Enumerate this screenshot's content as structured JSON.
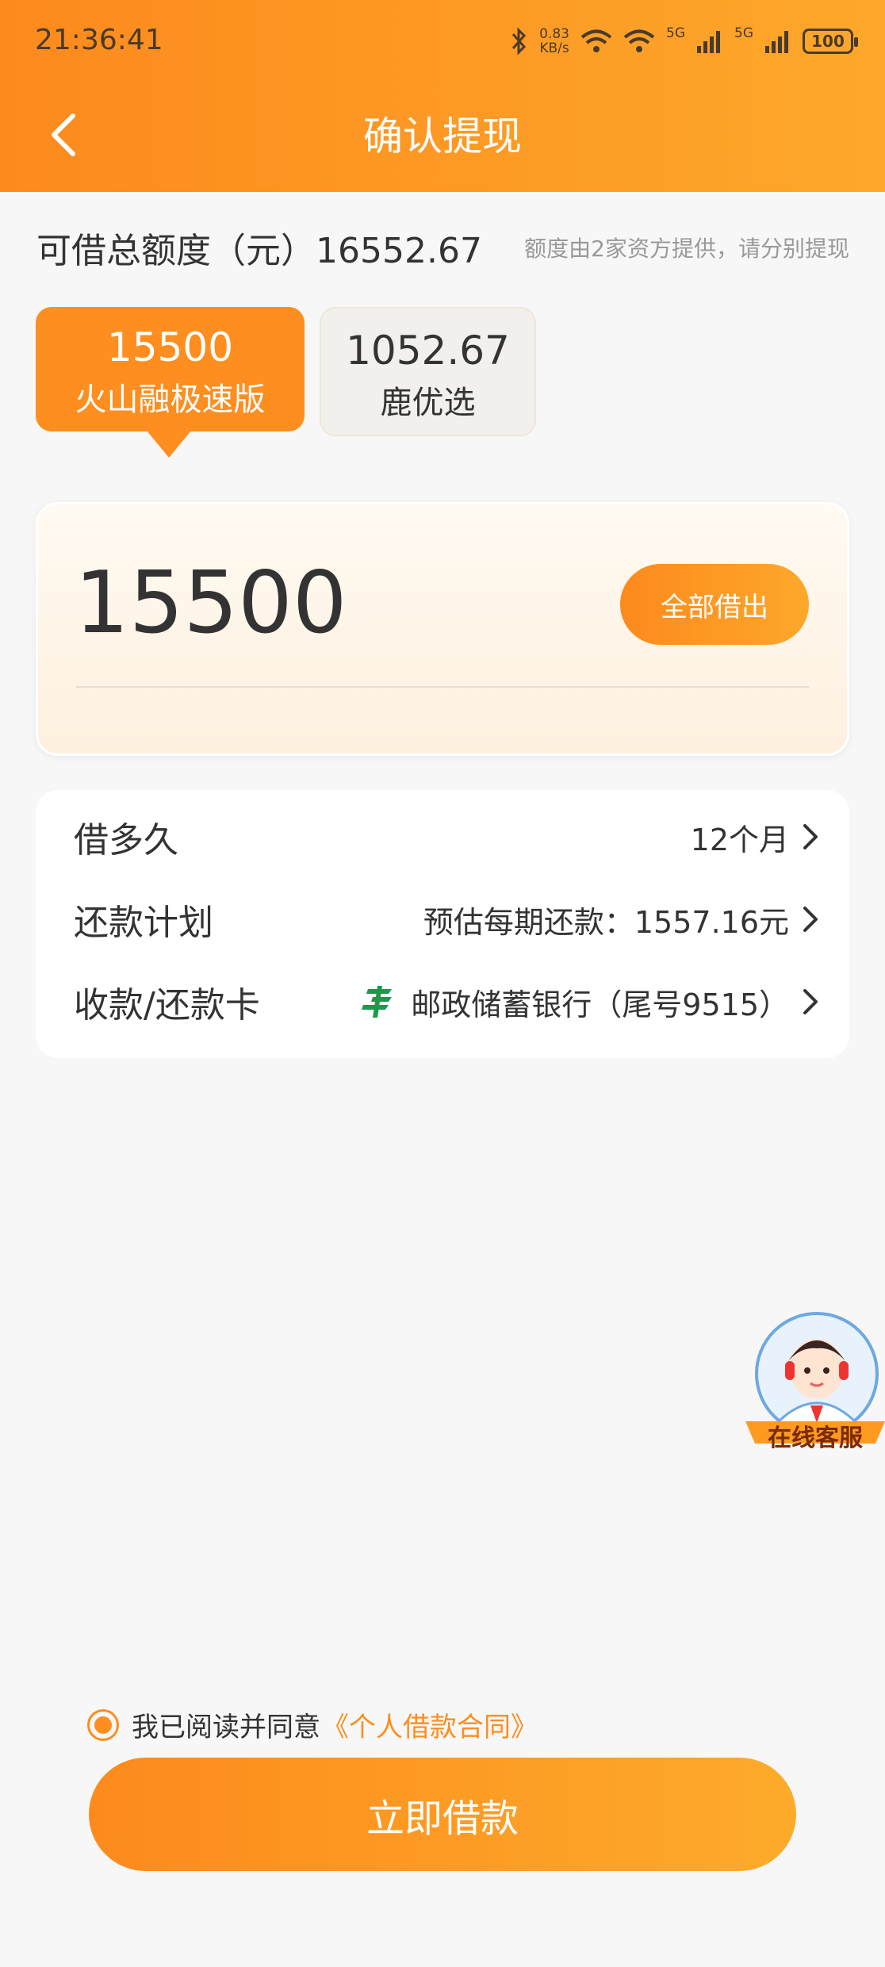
{
  "status": {
    "time": "21:36:41",
    "net_speed": "0.83",
    "net_unit": "KB/s",
    "sim1": "5G",
    "sim2": "5G",
    "battery": "100"
  },
  "header": {
    "title": "确认提现"
  },
  "quota": {
    "label": "可借总额度（元）16552.67",
    "note": "额度由2家资方提供，请分别提现"
  },
  "providers": [
    {
      "amount": "15500",
      "name": "火山融极速版"
    },
    {
      "amount": "1052.67",
      "name": "鹿优选"
    }
  ],
  "loan": {
    "amount": "15500",
    "borrow_all": "全部借出"
  },
  "details": {
    "term_label": "借多久",
    "term_value": "12个月",
    "plan_label": "还款计划",
    "plan_value": "预估每期还款：1557.16元",
    "card_label": "收款/还款卡",
    "card_value": "邮政储蓄银行（尾号9515）"
  },
  "service": {
    "label": "在线客服"
  },
  "agreement": {
    "text": "我已阅读并同意",
    "link": "《个人借款合同》"
  },
  "submit": {
    "label": "立即借款"
  },
  "colors": {
    "accent": "#fd8e1f",
    "bank_green": "#1b9a4a"
  }
}
